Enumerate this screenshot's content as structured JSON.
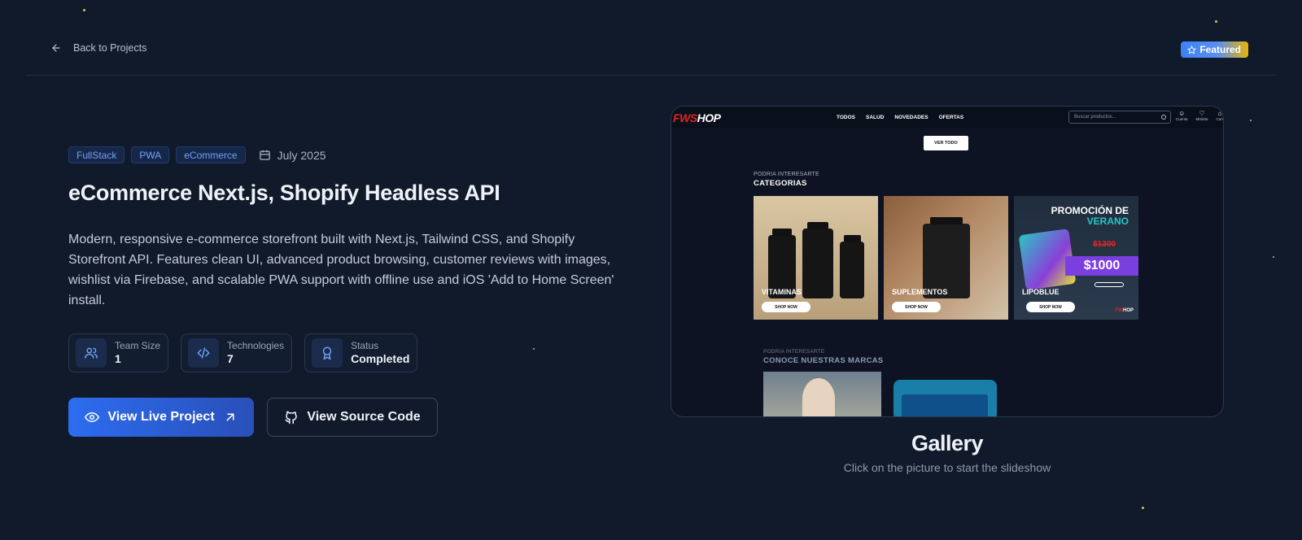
{
  "topbar": {
    "back_label": "Back to Projects",
    "featured_label": "Featured"
  },
  "project": {
    "tags": [
      "FullStack",
      "PWA",
      "eCommerce"
    ],
    "date": "July 2025",
    "title": "eCommerce Next.js, Shopify Headless API",
    "description": "Modern, responsive e-commerce storefront built with Next.js, Tailwind CSS, and Shopify Storefront API. Features clean UI, advanced product browsing, customer reviews with images, wishlist via Firebase, and scalable PWA support with offline use and iOS 'Add to Home Screen' install.",
    "stats": [
      {
        "label": "Team Size",
        "value": "1",
        "icon": "users-icon"
      },
      {
        "label": "Technologies",
        "value": "7",
        "icon": "code-icon"
      },
      {
        "label": "Status",
        "value": "Completed",
        "icon": "award-icon"
      }
    ],
    "buttons": {
      "live": "View Live Project",
      "source": "View Source Code"
    }
  },
  "preview": {
    "logo_red": "FWS",
    "logo_white": "HOP",
    "menu": [
      "TODOS",
      "SALUD",
      "NOVEDADES",
      "OFERTAS"
    ],
    "search_placeholder": "Buscar productos...",
    "icons": [
      {
        "label": "Cuenta"
      },
      {
        "label": "Mislista"
      },
      {
        "label": "Carr"
      }
    ],
    "ver_todo": "VER TODO",
    "section1": {
      "small": "PODRIA INTERESARTE",
      "heading": "CATEGORIAS"
    },
    "cards": [
      {
        "name": "VITAMINAS",
        "button": "SHOP NOW"
      },
      {
        "name": "SUPLEMENTOS",
        "button": "SHOP NOW"
      },
      {
        "name": "LIPOBLUE",
        "button": "SHOP NOW",
        "promo_top": "PROMOCIÓN DE",
        "promo_bottom": "VERANO",
        "old_price": "$1300",
        "new_price": "$1000",
        "mini_logo_red": "FW",
        "mini_logo_white": "HOP"
      }
    ],
    "section2": {
      "small": "PODRIA INTERESARTE",
      "heading": "CONOCE NUESTRAS MARCAS"
    }
  },
  "gallery": {
    "title": "Gallery",
    "subtitle": "Click on the picture to start the slideshow"
  },
  "colors": {
    "background": "#111a2b",
    "primary": "#2c6df0",
    "featured_end": "#eab308",
    "tag_text": "#6fa0f5"
  }
}
